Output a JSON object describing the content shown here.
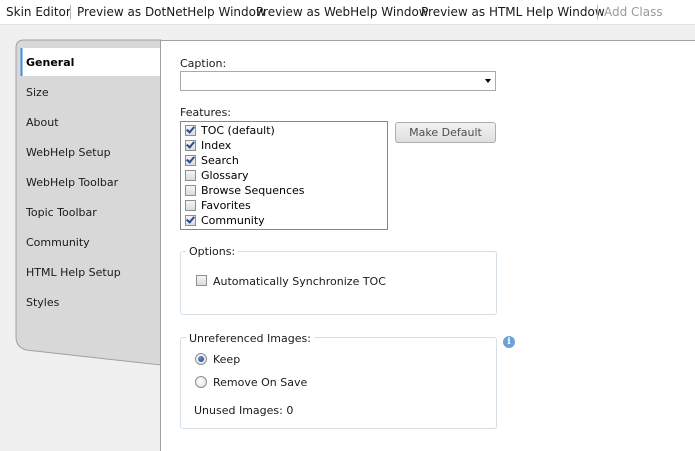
{
  "toolbar": {
    "skin_editor": "Skin Editor",
    "preview_dotnethelp": "Preview as DotNetHelp Window",
    "preview_webhelp": "Preview as WebHelp Window",
    "preview_htmlhelp": "Preview as HTML Help Window",
    "add_class": "Add Class"
  },
  "sidebar": {
    "items": [
      {
        "label": "General",
        "selected": true
      },
      {
        "label": "Size"
      },
      {
        "label": "About"
      },
      {
        "label": "WebHelp Setup"
      },
      {
        "label": "WebHelp Toolbar"
      },
      {
        "label": "Topic Toolbar"
      },
      {
        "label": "Community"
      },
      {
        "label": "HTML Help Setup"
      },
      {
        "label": "Styles"
      }
    ]
  },
  "general": {
    "caption_label": "Caption:",
    "caption_value": "",
    "features_label": "Features:",
    "features": [
      {
        "label": "TOC (default)",
        "checked": true
      },
      {
        "label": "Index",
        "checked": true
      },
      {
        "label": "Search",
        "checked": true
      },
      {
        "label": "Glossary",
        "checked": false
      },
      {
        "label": "Browse Sequences",
        "checked": false
      },
      {
        "label": "Favorites",
        "checked": false
      },
      {
        "label": "Community",
        "checked": true
      }
    ],
    "make_default_label": "Make Default",
    "options_title": "Options:",
    "auto_sync_label": "Automatically Synchronize TOC",
    "auto_sync_checked": false,
    "unreferenced_title": "Unreferenced Images:",
    "keep_label": "Keep",
    "remove_label": "Remove On Save",
    "selected_option": "Keep",
    "unused_images": "Unused Images: 0",
    "info_glyph": "i"
  },
  "colors": {
    "accent": "#1d3f8a",
    "info": "#6fa1d8",
    "sidebar_bg": "#d8d8d8",
    "panel_bg": "#f0f0f0"
  }
}
